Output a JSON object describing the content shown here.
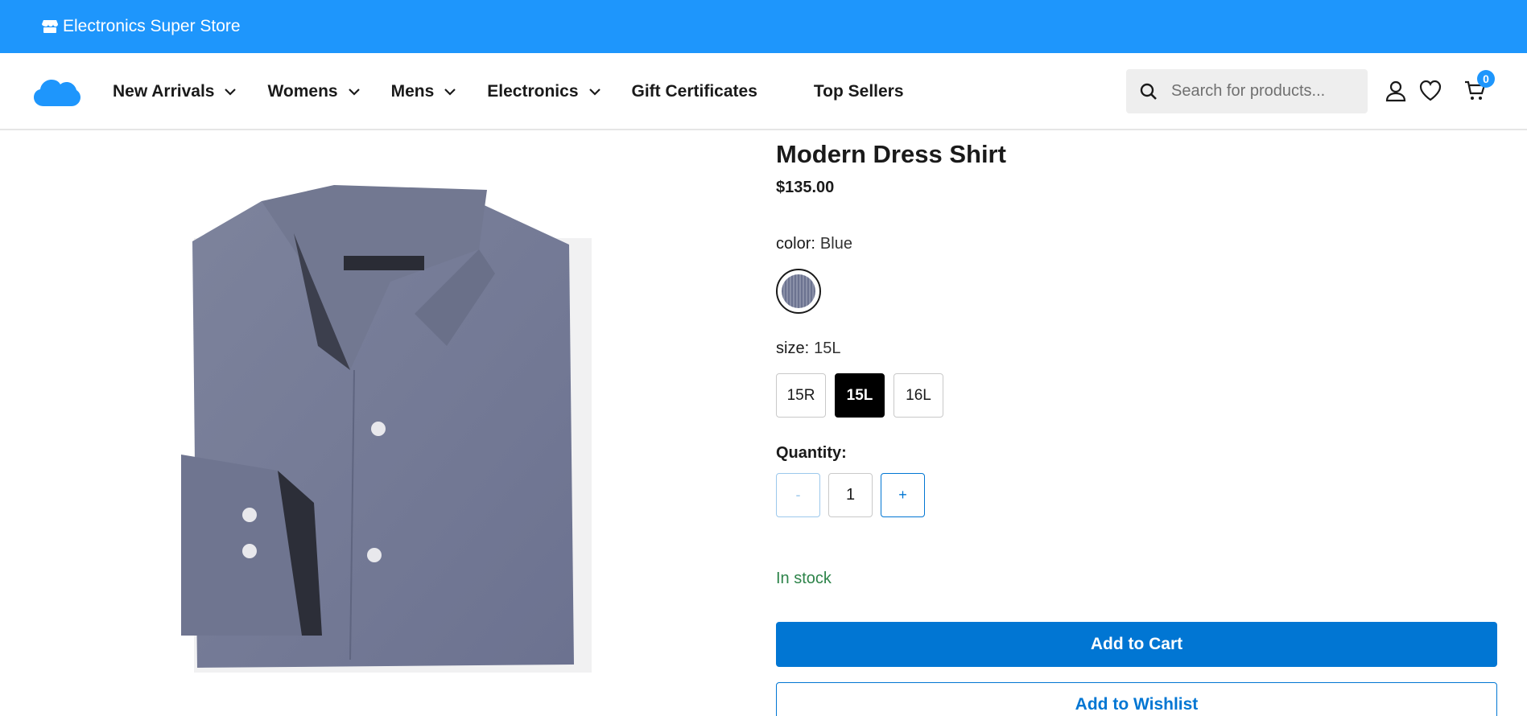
{
  "banner": {
    "store_name": "Electronics Super Store",
    "icon": "store-icon"
  },
  "header": {
    "logo": "cloud-logo",
    "nav": [
      {
        "label": "New Arrivals",
        "dropdown": true
      },
      {
        "label": "Womens",
        "dropdown": true
      },
      {
        "label": "Mens",
        "dropdown": true
      },
      {
        "label": "Electronics",
        "dropdown": true
      },
      {
        "label": "Gift Certificates",
        "dropdown": false
      },
      {
        "label": "Top Sellers",
        "dropdown": false
      }
    ],
    "search": {
      "placeholder": "Search for products..."
    },
    "cart_count": "0"
  },
  "product": {
    "title": "Modern Dress Shirt",
    "price": "$135.00",
    "color_label": "color:",
    "color_value": "Blue",
    "size_label": "size:",
    "size_value": "15L",
    "sizes": [
      "15R",
      "15L",
      "16L"
    ],
    "selected_size": "15L",
    "quantity_label": "Quantity:",
    "quantity_minus": "-",
    "quantity_value": "1",
    "quantity_plus": "+",
    "stock": "In stock",
    "add_to_cart": "Add to Cart",
    "add_to_wishlist": "Add to Wishlist"
  },
  "colors": {
    "banner": "#1e96fc",
    "primary": "#0176d3",
    "stock": "#2e844a"
  }
}
